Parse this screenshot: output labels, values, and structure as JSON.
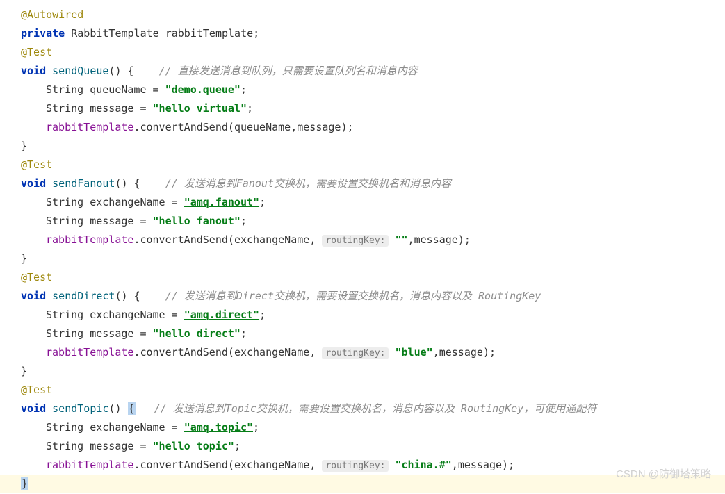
{
  "annotations": {
    "autowired": "@Autowired",
    "test": "@Test"
  },
  "keywords": {
    "private": "private",
    "void": "void"
  },
  "types": {
    "rabbitTemplate": "RabbitTemplate",
    "string": "String"
  },
  "fields": {
    "rabbitTemplate": "rabbitTemplate"
  },
  "methods": {
    "sendQueue": "sendQueue",
    "sendFanout": "sendFanout",
    "sendDirect": "sendDirect",
    "sendTopic": "sendTopic",
    "convertAndSend": "convertAndSend"
  },
  "variables": {
    "queueName": "queueName",
    "exchangeName": "exchangeName",
    "message": "message"
  },
  "strings": {
    "demoQueue": "\"demo.queue\"",
    "helloVirtual": "\"hello virtual\"",
    "amqFanout": "\"amq.fanout\"",
    "helloFanout": "\"hello fanout\"",
    "empty": "\"\"",
    "amqDirect": "\"amq.direct\"",
    "helloDirect": "\"hello direct\"",
    "blue": "\"blue\"",
    "amqTopic": "\"amq.topic\"",
    "helloTopic": "\"hello topic\"",
    "chinaHash": "\"china.#\""
  },
  "comments": {
    "sendQueue": "// 直接发送消息到队列，只需要设置队列名和消息内容",
    "sendFanout": "// 发送消息到Fanout交换机，需要设置交换机名和消息内容",
    "sendDirect": "// 发送消息到Direct交换机，需要设置交换机名，消息内容以及 RoutingKey",
    "sendTopic": "// 发送消息到Topic交换机，需要设置交换机名，消息内容以及 RoutingKey，可使用通配符"
  },
  "hints": {
    "routingKey": "routingKey:"
  },
  "punct": {
    "openParen": "(",
    "closeParen": ")",
    "openBrace": "{",
    "closeBrace": "}",
    "semicolon": ";",
    "comma": ",",
    "emptyParens": "()",
    "equals": " = "
  },
  "watermark": "CSDN @防御塔策略"
}
